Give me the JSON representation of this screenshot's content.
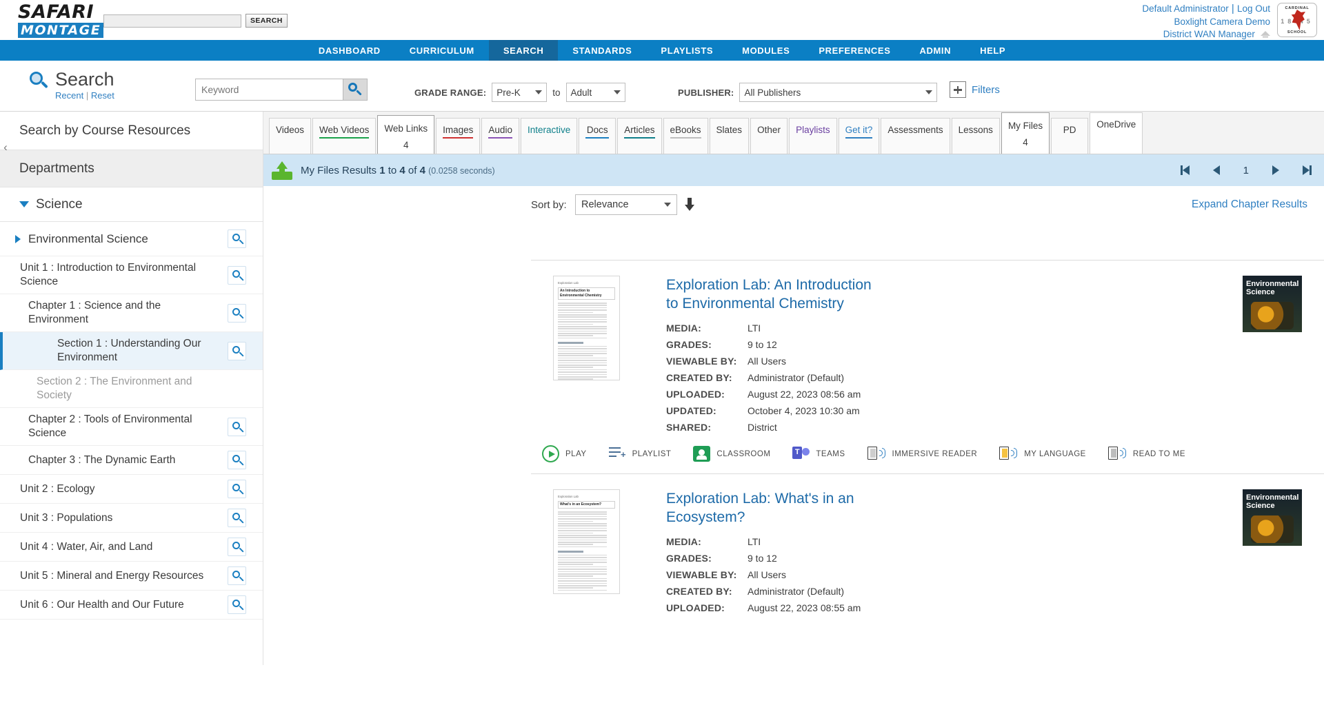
{
  "header": {
    "logo_line1": "SAFARI",
    "logo_line2": "MONTAGE",
    "search_value": "",
    "search_placeholder": "",
    "search_button": "SEARCH",
    "user_name": "Default Administrator",
    "separator": "|",
    "logout": "Log Out",
    "org": "Boxlight Camera Demo",
    "role": "District WAN Manager",
    "school_logo": {
      "top_text": "CARDINAL",
      "bottom_text": "SCHOOL",
      "year": "18    45"
    }
  },
  "nav": {
    "items": [
      {
        "label": "DASHBOARD",
        "active": false
      },
      {
        "label": "CURRICULUM",
        "active": false
      },
      {
        "label": "SEARCH",
        "active": true
      },
      {
        "label": "STANDARDS",
        "active": false
      },
      {
        "label": "PLAYLISTS",
        "active": false
      },
      {
        "label": "MODULES",
        "active": false
      },
      {
        "label": "PREFERENCES",
        "active": false
      },
      {
        "label": "ADMIN",
        "active": false
      },
      {
        "label": "HELP",
        "active": false
      }
    ]
  },
  "searchbar": {
    "title": "Search",
    "recent": "Recent",
    "divider": "|",
    "reset": "Reset",
    "keyword_value": "Keyword",
    "keyword_placeholder": "Keyword",
    "grade_range_label": "GRADE RANGE:",
    "grade_from": "Pre-K",
    "grade_to_word": "to",
    "grade_to": "Adult",
    "publisher_label": "PUBLISHER:",
    "publisher_value": "All Publishers",
    "filters_label": "Filters"
  },
  "sidebar": {
    "collapse_icon": "‹",
    "heading": "Search by Course Resources",
    "departments": "Departments",
    "science": "Science",
    "course": "Environmental Science",
    "tree": [
      {
        "label": "Unit 1 : Introduction to Environmental Science",
        "level": 0,
        "search": true,
        "selected": false,
        "dim": false
      },
      {
        "label": "Chapter 1 : Science and the Environment",
        "level": 1,
        "search": true,
        "selected": false,
        "dim": false
      },
      {
        "label": "Section 1 : Understanding Our Environment",
        "level": 2,
        "search": true,
        "selected": true,
        "dim": false
      },
      {
        "label": "Section 2 : The Environment and Society",
        "level": 2,
        "search": false,
        "selected": false,
        "dim": true
      },
      {
        "label": "Chapter 2 : Tools of Environmental Science",
        "level": 1,
        "search": true,
        "selected": false,
        "dim": false
      },
      {
        "label": "Chapter 3 : The Dynamic Earth",
        "level": 1,
        "search": true,
        "selected": false,
        "dim": false
      },
      {
        "label": "Unit 2 : Ecology",
        "level": 0,
        "search": true,
        "selected": false,
        "dim": false
      },
      {
        "label": "Unit 3 : Populations",
        "level": 0,
        "search": true,
        "selected": false,
        "dim": false
      },
      {
        "label": "Unit 4 : Water, Air, and Land",
        "level": 0,
        "search": true,
        "selected": false,
        "dim": false
      },
      {
        "label": "Unit 5 : Mineral and Energy Resources",
        "level": 0,
        "search": true,
        "selected": false,
        "dim": false
      },
      {
        "label": "Unit 6 : Our Health and Our Future",
        "level": 0,
        "search": true,
        "selected": false,
        "dim": false
      }
    ]
  },
  "tabs": [
    {
      "label": "Videos",
      "count": "",
      "active": false,
      "style": "videos"
    },
    {
      "label": "Web Videos",
      "count": "",
      "active": false,
      "style": "webvideos"
    },
    {
      "label": "Web Links",
      "count": "4",
      "active": true,
      "style": "weblinks"
    },
    {
      "label": "Images",
      "count": "",
      "active": false,
      "style": "images"
    },
    {
      "label": "Audio",
      "count": "",
      "active": false,
      "style": "audio"
    },
    {
      "label": "Interactive",
      "count": "",
      "active": false,
      "style": "interactive"
    },
    {
      "label": "Docs",
      "count": "",
      "active": false,
      "style": "docs"
    },
    {
      "label": "Articles",
      "count": "",
      "active": false,
      "style": "articles"
    },
    {
      "label": "eBooks",
      "count": "",
      "active": false,
      "style": "ebooks"
    },
    {
      "label": "Slates",
      "count": "",
      "active": false,
      "style": "slates"
    },
    {
      "label": "Other",
      "count": "",
      "active": false,
      "style": "other"
    },
    {
      "label": "Playlists",
      "count": "",
      "active": false,
      "style": "playlists-t"
    },
    {
      "label": "Get it?",
      "count": "",
      "active": false,
      "style": "getit"
    },
    {
      "label": "Assessments",
      "count": "",
      "active": false,
      "style": "assessments"
    },
    {
      "label": "Lessons",
      "count": "",
      "active": false,
      "style": "lessons"
    },
    {
      "label": "My Files",
      "count": "4",
      "active": true,
      "style": "myfiles"
    },
    {
      "label": "PD",
      "count": "",
      "active": false,
      "style": "pd"
    },
    {
      "label": "OneDrive",
      "count": "",
      "active": false,
      "style": "onedrive"
    }
  ],
  "results_bar": {
    "prefix": "My Files Results",
    "range_start": "1",
    "range_word": "to",
    "range_end": "4",
    "of_word": "of",
    "total": "4",
    "timing": "(0.0258 seconds)",
    "page_number": "1"
  },
  "sort": {
    "label": "Sort by:",
    "value": "Relevance",
    "expand": "Expand Chapter Results"
  },
  "results": [
    {
      "title": "Exploration Lab: An Introduction to Environmental Chemistry",
      "thumb_heading": "An Introduction to Environmental Chemistry",
      "thumb_kicker": "Exploration Lab",
      "cover_title": "Environmental Science",
      "meta": [
        {
          "key": "MEDIA:",
          "value": "LTI"
        },
        {
          "key": "GRADES:",
          "value": "9 to 12"
        },
        {
          "key": "VIEWABLE BY:",
          "value": "All Users"
        },
        {
          "key": "CREATED BY:",
          "value": "Administrator (Default)"
        },
        {
          "key": "UPLOADED:",
          "value": "August 22, 2023 08:56 am"
        },
        {
          "key": "UPDATED:",
          "value": "October 4, 2023 10:30 am"
        },
        {
          "key": "SHARED:",
          "value": "District"
        }
      ],
      "actions": [
        {
          "label": "PLAY",
          "icon": "play-icon"
        },
        {
          "label": "PLAYLIST",
          "icon": "playlist-add-icon"
        },
        {
          "label": "CLASSROOM",
          "icon": "google-classroom-icon"
        },
        {
          "label": "TEAMS",
          "icon": "microsoft-teams-icon"
        },
        {
          "label": "IMMERSIVE READER",
          "icon": "immersive-reader-icon"
        },
        {
          "label": "MY LANGUAGE",
          "icon": "my-language-icon"
        },
        {
          "label": "READ TO ME",
          "icon": "read-to-me-icon"
        }
      ]
    },
    {
      "title": "Exploration Lab: What's in an Ecosystem?",
      "thumb_heading": "What's in an Ecosystem?",
      "thumb_kicker": "Exploration Lab",
      "cover_title": "Environmental Science",
      "meta": [
        {
          "key": "MEDIA:",
          "value": "LTI"
        },
        {
          "key": "GRADES:",
          "value": "9 to 12"
        },
        {
          "key": "VIEWABLE BY:",
          "value": "All Users"
        },
        {
          "key": "CREATED BY:",
          "value": "Administrator (Default)"
        },
        {
          "key": "UPLOADED:",
          "value": "August 22, 2023 08:55 am"
        }
      ],
      "actions": []
    }
  ],
  "colors": {
    "nav_blue": "#0b7fc4",
    "nav_active": "#15679c",
    "link_blue": "#2f7fc1",
    "result_bar": "#cfe5f5",
    "title_blue": "#1d6aa8"
  }
}
